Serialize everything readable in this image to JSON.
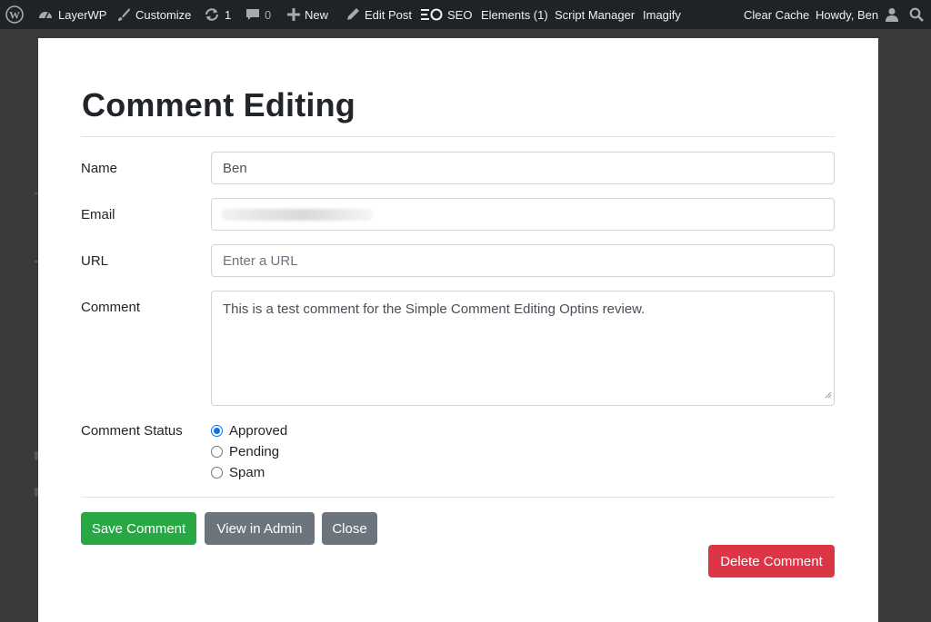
{
  "admin_bar": {
    "site_name": "LayerWP",
    "customize": "Customize",
    "updates_count": "1",
    "comments_count": "0",
    "new": "New",
    "edit_post": "Edit Post",
    "seo": "SEO",
    "elements": "Elements (1)",
    "script_manager": "Script Manager",
    "imagify": "Imagify",
    "clear_cache": "Clear Cache",
    "howdy": "Howdy, Ben",
    "icons": [
      "wordpress-logo-icon",
      "dashboard-icon",
      "brush-icon",
      "updates-icon",
      "comment-icon",
      "plus-icon",
      "pencil-icon",
      "seo-icon",
      "user-icon",
      "search-icon"
    ]
  },
  "modal": {
    "title": "Comment Editing",
    "fields": {
      "name": {
        "label": "Name",
        "value": "Ben"
      },
      "email": {
        "label": "Email"
      },
      "url": {
        "label": "URL",
        "placeholder": "Enter a URL"
      },
      "comment": {
        "label": "Comment",
        "value": "This is a test comment for the Simple Comment Editing Optins review."
      }
    },
    "status": {
      "label": "Comment Status",
      "options": [
        "Approved",
        "Pending",
        "Spam"
      ],
      "selected": "Approved"
    },
    "buttons": {
      "save": "Save Comment",
      "view_admin": "View in Admin",
      "close": "Close",
      "delete": "Delete Comment"
    }
  },
  "colors": {
    "admin_bar": "#1d2327",
    "success": "#28a745",
    "secondary": "#6c757d",
    "danger": "#dc3545",
    "radio_accent": "#0b74e5"
  }
}
